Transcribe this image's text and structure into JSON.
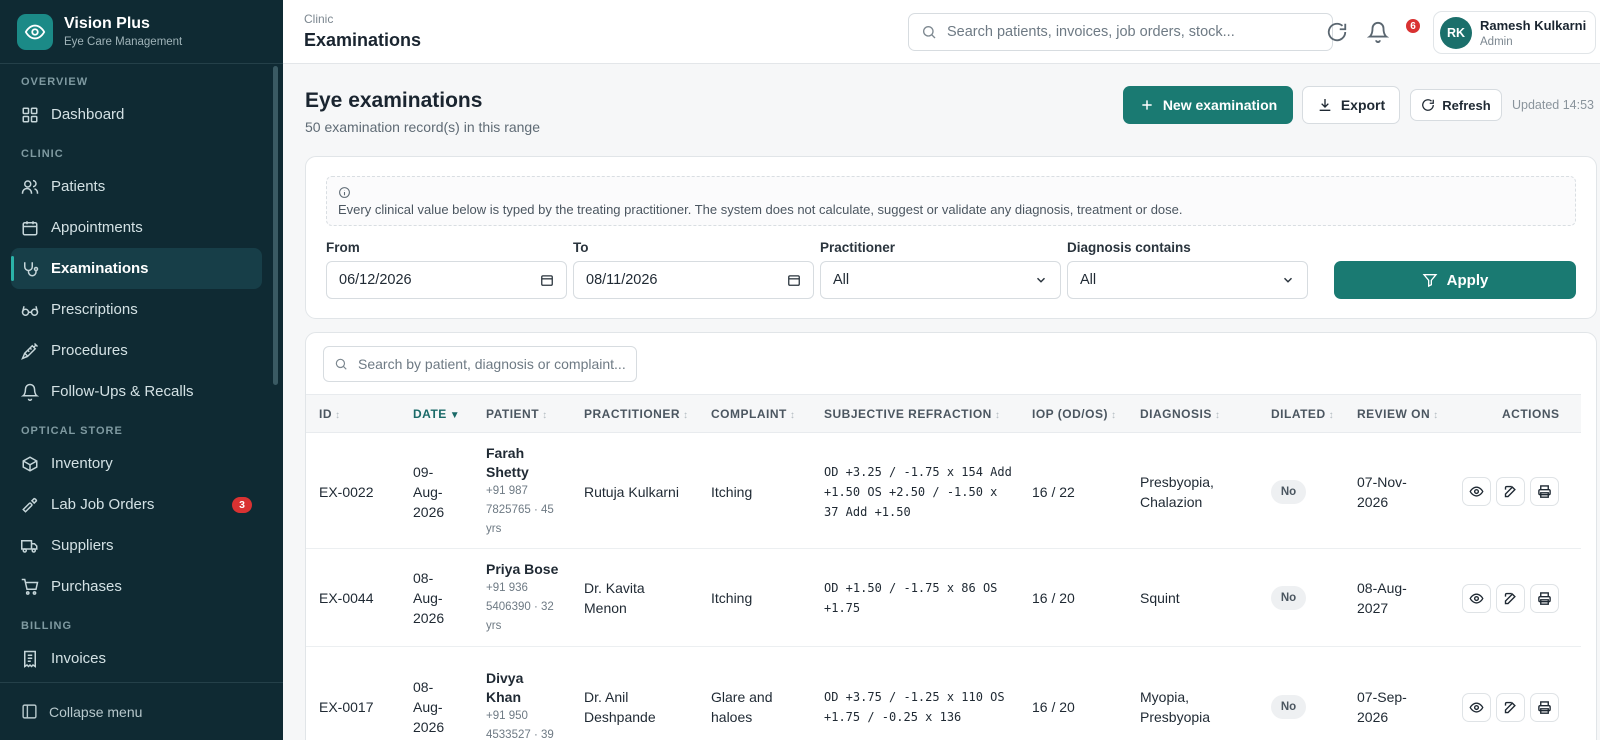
{
  "brand": {
    "name": "Vision Plus",
    "subtitle": "Eye Care Management"
  },
  "sidebar": {
    "sections": {
      "overview": "OVERVIEW",
      "clinic": "CLINIC",
      "optical": "OPTICAL STORE",
      "billing": "BILLING"
    },
    "items": [
      {
        "label": "Dashboard",
        "icon": "grid-icon"
      },
      {
        "label": "Patients",
        "icon": "users-icon"
      },
      {
        "label": "Appointments",
        "icon": "calendar-icon"
      },
      {
        "label": "Examinations",
        "icon": "stethoscope-icon",
        "active": true
      },
      {
        "label": "Prescriptions",
        "icon": "glasses-icon"
      },
      {
        "label": "Procedures",
        "icon": "syringe-icon"
      },
      {
        "label": "Follow-Ups & Recalls",
        "icon": "bell-icon"
      },
      {
        "label": "Inventory",
        "icon": "box-icon"
      },
      {
        "label": "Lab Job Orders",
        "icon": "hammer-icon",
        "badge": "3"
      },
      {
        "label": "Suppliers",
        "icon": "truck-icon"
      },
      {
        "label": "Purchases",
        "icon": "cart-icon"
      },
      {
        "label": "Invoices",
        "icon": "receipt-icon"
      }
    ],
    "collapse": "Collapse menu"
  },
  "topbar": {
    "breadcrumb": "Clinic",
    "title": "Examinations",
    "search_placeholder": "Search patients, invoices, job orders, stock...",
    "notifications": "6",
    "user": {
      "initials": "RK",
      "name": "Ramesh Kulkarni",
      "role": "Admin"
    }
  },
  "page": {
    "title": "Eye examinations",
    "subtitle": "50 examination record(s) in this range",
    "new_btn": "New examination",
    "export_btn": "Export",
    "refresh_btn": "Refresh",
    "updated": "Updated 14:53"
  },
  "filters": {
    "notice": "Every clinical value below is typed by the treating practitioner. The system does not calculate, suggest or validate any diagnosis, treatment or dose.",
    "from_label": "From",
    "from_value": "06/12/2026",
    "to_label": "To",
    "to_value": "08/11/2026",
    "practitioner_label": "Practitioner",
    "practitioner_value": "All",
    "diagnosis_label": "Diagnosis contains",
    "diagnosis_value": "All",
    "apply": "Apply"
  },
  "table": {
    "search_placeholder": "Search by patient, diagnosis or complaint...",
    "columns": [
      "ID",
      "DATE",
      "PATIENT",
      "PRACTITIONER",
      "COMPLAINT",
      "SUBJECTIVE REFRACTION",
      "IOP (OD/OS)",
      "DIAGNOSIS",
      "DILATED",
      "REVIEW ON",
      "ACTIONS"
    ],
    "rows": [
      {
        "id": "EX-0022",
        "date": [
          "09-",
          "Aug-",
          "2026"
        ],
        "name": [
          "Farah",
          "Shetty"
        ],
        "info": [
          "+91 987",
          "7825765 · 45",
          "yrs"
        ],
        "practitioner": [
          "Rutuja Kulkarni"
        ],
        "complaint": [
          "Itching"
        ],
        "refraction": [
          "OD +3.25 / -1.75 x 154 Add",
          "+1.50 OS +2.50 / -1.50 x",
          "37 Add +1.50"
        ],
        "iop": "16 / 22",
        "diagnosis": [
          "Presbyopia,",
          "Chalazion"
        ],
        "dilated": "No",
        "review": [
          "07-Nov-",
          "2026"
        ]
      },
      {
        "id": "EX-0044",
        "date": [
          "08-",
          "Aug-",
          "2026"
        ],
        "name": [
          "Priya Bose"
        ],
        "info": [
          "+91 936",
          "5406390 · 32",
          "yrs"
        ],
        "practitioner": [
          "Dr. Kavita",
          "Menon"
        ],
        "complaint": [
          "Itching"
        ],
        "refraction": [
          "OD +1.50 / -1.75 x 86 OS",
          "+1.75"
        ],
        "iop": "16 / 20",
        "diagnosis": [
          "Squint"
        ],
        "dilated": "No",
        "review": [
          "08-Aug-",
          "2027"
        ]
      },
      {
        "id": "EX-0017",
        "date": [
          "08-",
          "Aug-",
          "2026"
        ],
        "name": [
          "Divya",
          "Khan"
        ],
        "info": [
          "+91 950",
          "4533527 · 39"
        ],
        "practitioner": [
          "Dr. Anil",
          "Deshpande"
        ],
        "complaint": [
          "Glare and",
          "haloes"
        ],
        "refraction": [
          "OD +3.75 / -1.25 x 110 OS",
          "+1.75 / -0.25 x 136"
        ],
        "iop": "16 / 20",
        "diagnosis": [
          "Myopia,",
          "Presbyopia"
        ],
        "dilated": "No",
        "review": [
          "07-Sep-",
          "2026"
        ]
      }
    ]
  }
}
